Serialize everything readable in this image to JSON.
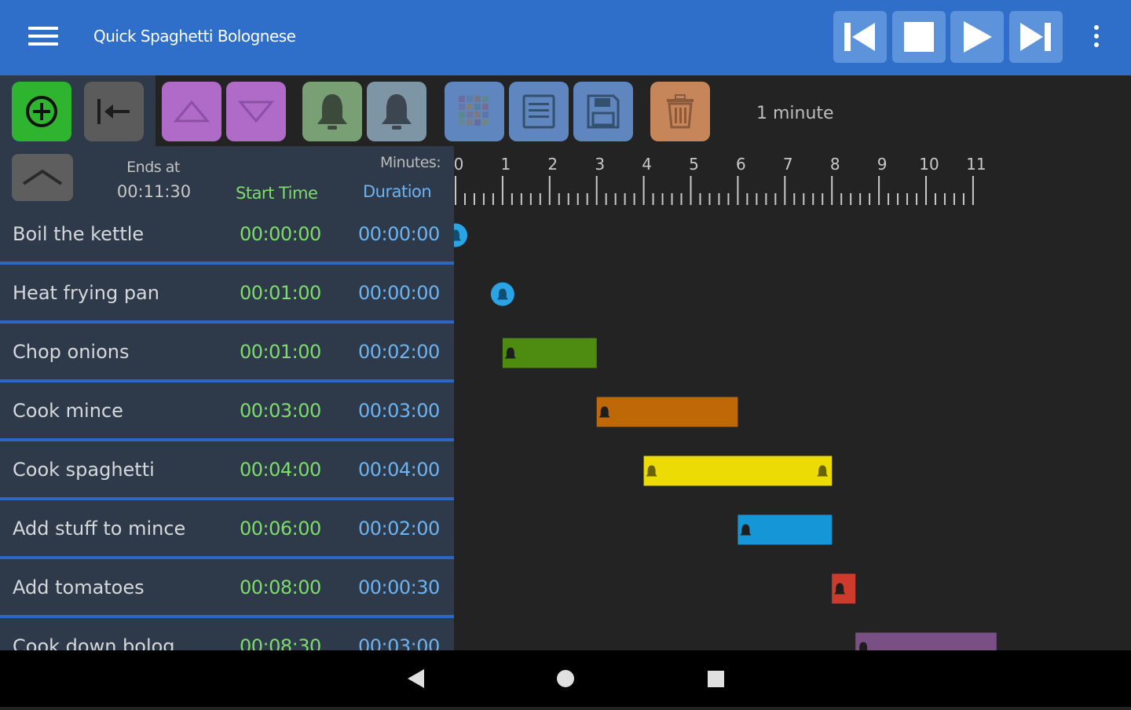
{
  "app": {
    "title": "Quick Spaghetti Bolognese"
  },
  "toolbar": {
    "interval_label": "1 minute"
  },
  "header": {
    "ends_label": "Ends at",
    "ends_time": "00:11:30",
    "start_col": "Start Time",
    "duration_col": "Duration",
    "minutes_label": "Minutes:",
    "ruler_ticks": [
      "0",
      "1",
      "2",
      "3",
      "4",
      "5",
      "6",
      "7",
      "8",
      "9",
      "10",
      "11"
    ]
  },
  "tasks": [
    {
      "name": "Boil the kettle",
      "start": "00:00:00",
      "duration": "00:00:00",
      "start_min": 0,
      "dur_min": 0,
      "color": "#2aa4e4"
    },
    {
      "name": "Heat frying pan",
      "start": "00:01:00",
      "duration": "00:00:00",
      "start_min": 1,
      "dur_min": 0,
      "color": "#2aa4e4"
    },
    {
      "name": "Chop onions",
      "start": "00:01:00",
      "duration": "00:02:00",
      "start_min": 1,
      "dur_min": 2,
      "color": "#4e8c11"
    },
    {
      "name": "Cook mince",
      "start": "00:03:00",
      "duration": "00:03:00",
      "start_min": 3,
      "dur_min": 3,
      "color": "#bf6808"
    },
    {
      "name": "Cook spaghetti",
      "start": "00:04:00",
      "duration": "00:04:00",
      "start_min": 4,
      "dur_min": 4,
      "color": "#ecdb05"
    },
    {
      "name": "Add stuff to mince",
      "start": "00:06:00",
      "duration": "00:02:00",
      "start_min": 6,
      "dur_min": 2,
      "color": "#1597d7"
    },
    {
      "name": "Add tomatoes",
      "start": "00:08:00",
      "duration": "00:00:30",
      "start_min": 8,
      "dur_min": 0.5,
      "color": "#cc3b2c"
    },
    {
      "name": "Cook down bolog",
      "start": "00:08:30",
      "duration": "00:03:00",
      "start_min": 8.5,
      "dur_min": 3,
      "color": "#7a4f85"
    }
  ],
  "colors": {
    "app_bar": "#2f6fca",
    "list_bg": "#2e3a49",
    "row_divider": "#2e66c6",
    "start_text": "#7ddc6b",
    "duration_text": "#6cb3f2"
  },
  "icons": {
    "menu": "hamburger-icon",
    "skip_back": "skip-to-start-icon",
    "stop": "stop-icon",
    "play": "play-icon",
    "skip_forward": "skip-to-end-icon",
    "overflow": "more-vert-icon",
    "add": "add-circle-icon",
    "go_start": "arrow-to-start-icon",
    "move_up": "triangle-up-icon",
    "move_down": "triangle-down-icon",
    "alarm_start": "bell-icon",
    "alarm_end": "bell-icon",
    "color": "palette-grid-icon",
    "notes": "notes-icon",
    "save": "floppy-disk-icon",
    "delete": "trash-icon",
    "collapse": "chevron-up-icon"
  }
}
